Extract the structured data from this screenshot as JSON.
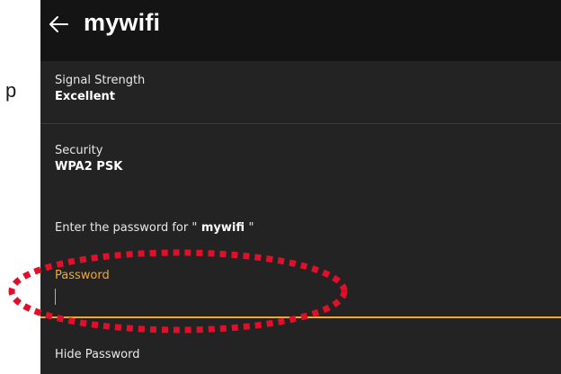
{
  "stray_text": "p",
  "header": {
    "back_icon": "arrow-left-icon",
    "title": "mywifi"
  },
  "signal": {
    "label": "Signal Strength",
    "value": "Excellent"
  },
  "security": {
    "label": "Security",
    "value": "WPA2 PSK"
  },
  "prompt": {
    "prefix": "Enter the password for \"",
    "network": " mywifi ",
    "suffix": "\""
  },
  "password": {
    "label": "Password",
    "value": "",
    "placeholder": ""
  },
  "hide_password": {
    "label": "Hide Password"
  },
  "colors": {
    "background": "#232323",
    "header": "#141414",
    "accent": "#f0a830",
    "annotation": "#e0102a"
  }
}
